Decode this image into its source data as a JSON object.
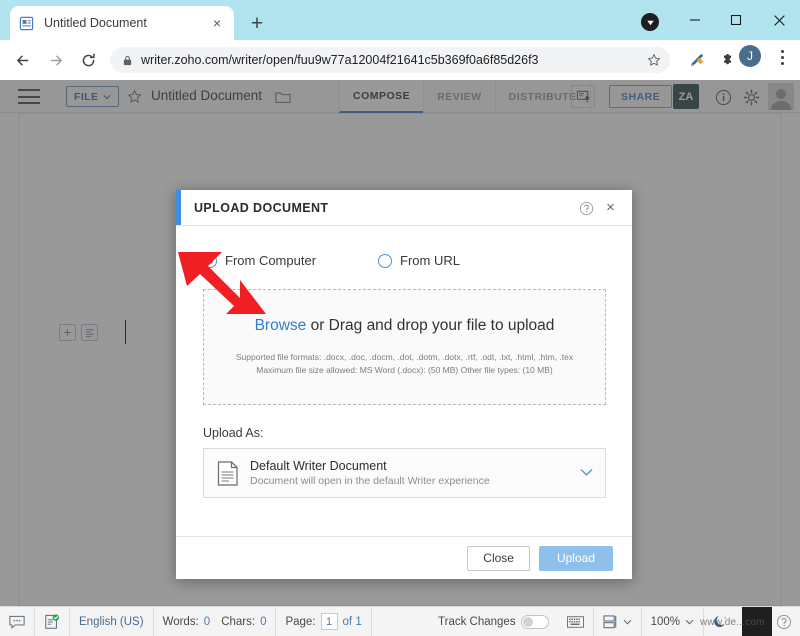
{
  "browser": {
    "tab": {
      "title": "Untitled Document",
      "favicon": "document-icon",
      "close": "×"
    },
    "new_tab_label": "+",
    "window_controls": {
      "minimize": "–",
      "maximize": "□",
      "close": "×"
    },
    "download_indicator": "download-arrow-icon",
    "nav": {
      "back": "back-arrow-icon",
      "forward": "forward-arrow-icon",
      "reload": "reload-icon"
    },
    "omnibox": {
      "lock": "lock-icon",
      "url": "writer.zoho.com/writer/open/fuu9w77a12004f21641c5b369f0a6f85d26f3",
      "bookmark": "star-icon"
    },
    "extensions": [
      "extension-pen-icon",
      "extension-puzzle-icon"
    ],
    "profile_initial": "J",
    "menu": "kebab-menu-icon",
    "titlebar_color": "#b2e4f0"
  },
  "app": {
    "menu_icon": "hamburger-icon",
    "file_menu": {
      "label": "FILE",
      "chevron": "⌄"
    },
    "favorite_icon": "star-outline-icon",
    "document_title": "Untitled Document",
    "folder_icon": "folder-icon",
    "mode_tabs": [
      {
        "label": "COMPOSE",
        "active": true
      },
      {
        "label": "REVIEW",
        "active": false
      },
      {
        "label": "DISTRIBUTE",
        "active": false
      }
    ],
    "notification_icon": "notification-bell-icon",
    "share_label": "SHARE",
    "za_badge": "ZA",
    "info_icon": "info-icon",
    "settings_icon": "gear-icon",
    "avatar": "user-avatar-icon",
    "paragraph_tools": [
      "insert-plus-icon",
      "paragraph-style-icon"
    ]
  },
  "dialog": {
    "title": "UPLOAD DOCUMENT",
    "help_icon": "help-question-icon",
    "close_icon": "×",
    "accent_color": "#3e8fe0",
    "source_options": [
      {
        "label": "From Computer",
        "selected": true
      },
      {
        "label": "From URL",
        "selected": false
      }
    ],
    "dropzone": {
      "browse_label": "Browse",
      "main_text": " or Drag and drop your file to upload",
      "formats_line": "Supported file formats: .docx, .doc, .docm, .dot, .dotm, .dotx, .rtf, .odt, .txt, .html, .htm, .tex",
      "size_line": "Maximum file size allowed: MS Word (.docx): (50 MB) Other file types: (10 MB)"
    },
    "upload_as_label": "Upload As:",
    "upload_as_value": {
      "icon": "document-icon",
      "title": "Default Writer Document",
      "subtitle": "Document will open in the default Writer experience",
      "chevron": "chevron-down-icon"
    },
    "buttons": {
      "close": "Close",
      "upload": "Upload"
    }
  },
  "statusbar": {
    "comment_icon": "comment-icon",
    "spellcheck_icon": "spellcheck-icon",
    "language": "English (US)",
    "words_label": "Words:",
    "words_value": "0",
    "chars_label": "Chars:",
    "chars_value": "0",
    "page_label": "Page:",
    "page_current": "1",
    "page_of": "of 1",
    "track_changes_label": "Track Changes",
    "track_changes_on": false,
    "keyboard_icon": "keyboard-icon",
    "layout_icon": "page-layout-icon",
    "layout_chevron": "chevron-down-icon",
    "zoom_value": "100%",
    "zoom_chevron": "chevron-down-icon",
    "night_icon": "night-mode-icon",
    "reader_icon": "reader-view-icon",
    "help_icon": "help-question-icon",
    "watermark": "www.de...com"
  }
}
